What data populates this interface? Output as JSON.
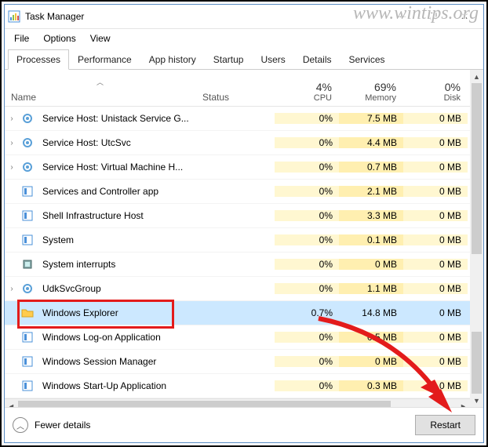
{
  "watermark": "www.wintips.org",
  "window": {
    "title": "Task Manager",
    "menu": [
      "File",
      "Options",
      "View"
    ]
  },
  "tabs": [
    "Processes",
    "Performance",
    "App history",
    "Startup",
    "Users",
    "Details",
    "Services"
  ],
  "active_tab": 0,
  "columns": {
    "name": "Name",
    "status": "Status",
    "cpu": {
      "pct": "4%",
      "label": "CPU"
    },
    "memory": {
      "pct": "69%",
      "label": "Memory"
    },
    "disk": {
      "pct": "0%",
      "label": "Disk"
    }
  },
  "rows": [
    {
      "exp": true,
      "icon": "gear",
      "name": "Service Host: Unistack Service G...",
      "cpu": "0%",
      "mem": "7.5 MB",
      "disk": "0 MB"
    },
    {
      "exp": true,
      "icon": "gear",
      "name": "Service Host: UtcSvc",
      "cpu": "0%",
      "mem": "4.4 MB",
      "disk": "0 MB"
    },
    {
      "exp": true,
      "icon": "gear",
      "name": "Service Host: Virtual Machine H...",
      "cpu": "0%",
      "mem": "0.7 MB",
      "disk": "0 MB"
    },
    {
      "exp": false,
      "icon": "app",
      "name": "Services and Controller app",
      "cpu": "0%",
      "mem": "2.1 MB",
      "disk": "0 MB"
    },
    {
      "exp": false,
      "icon": "app",
      "name": "Shell Infrastructure Host",
      "cpu": "0%",
      "mem": "3.3 MB",
      "disk": "0 MB"
    },
    {
      "exp": false,
      "icon": "app",
      "name": "System",
      "cpu": "0%",
      "mem": "0.1 MB",
      "disk": "0 MB"
    },
    {
      "exp": false,
      "icon": "chip",
      "name": "System interrupts",
      "cpu": "0%",
      "mem": "0 MB",
      "disk": "0 MB"
    },
    {
      "exp": true,
      "icon": "gear",
      "name": "UdkSvcGroup",
      "cpu": "0%",
      "mem": "1.1 MB",
      "disk": "0 MB"
    },
    {
      "exp": false,
      "icon": "folder",
      "name": "Windows Explorer",
      "cpu": "0.7%",
      "mem": "14.8 MB",
      "disk": "0 MB",
      "selected": true
    },
    {
      "exp": false,
      "icon": "app",
      "name": "Windows Log-on Application",
      "cpu": "0%",
      "mem": "0.5 MB",
      "disk": "0 MB"
    },
    {
      "exp": false,
      "icon": "app",
      "name": "Windows Session Manager",
      "cpu": "0%",
      "mem": "0 MB",
      "disk": "0 MB"
    },
    {
      "exp": false,
      "icon": "app",
      "name": "Windows Start-Up Application",
      "cpu": "0%",
      "mem": "0.3 MB",
      "disk": "0 MB"
    }
  ],
  "footer": {
    "fewer": "Fewer details",
    "action": "Restart"
  },
  "annotations": {
    "highlighted_row_index": 8,
    "arrow_from": "above-right",
    "arrow_to": "restart-button"
  }
}
